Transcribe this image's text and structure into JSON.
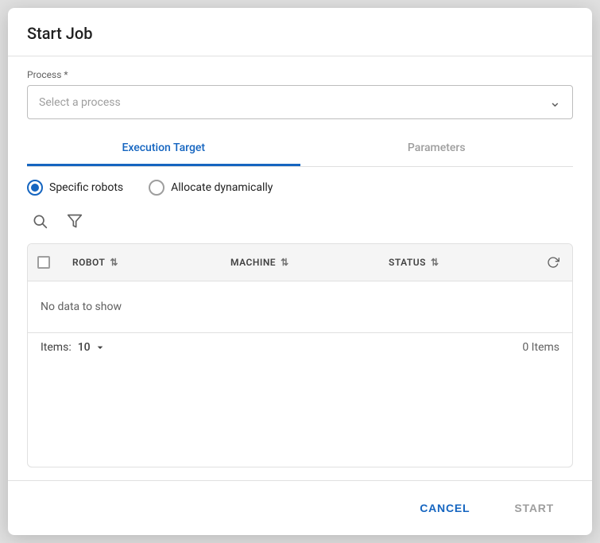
{
  "dialog": {
    "title": "Start Job"
  },
  "process": {
    "label": "Process *",
    "placeholder": "Select a process"
  },
  "tabs": [
    {
      "id": "execution-target",
      "label": "Execution Target",
      "active": true
    },
    {
      "id": "parameters",
      "label": "Parameters",
      "active": false
    }
  ],
  "radio_options": [
    {
      "id": "specific-robots",
      "label": "Specific robots",
      "checked": true
    },
    {
      "id": "allocate-dynamically",
      "label": "Allocate dynamically",
      "checked": false
    }
  ],
  "toolbar": {
    "search_icon": "search",
    "filter_icon": "filter"
  },
  "table": {
    "columns": [
      {
        "id": "checkbox",
        "label": ""
      },
      {
        "id": "robot",
        "label": "ROBOT"
      },
      {
        "id": "machine",
        "label": "MACHINE"
      },
      {
        "id": "status",
        "label": "STATUS"
      },
      {
        "id": "refresh",
        "label": ""
      }
    ],
    "no_data_text": "No data to show",
    "footer": {
      "items_label": "Items:",
      "items_per_page": "10",
      "total_items": "0 Items"
    }
  },
  "footer": {
    "cancel_label": "CANCEL",
    "start_label": "START"
  }
}
